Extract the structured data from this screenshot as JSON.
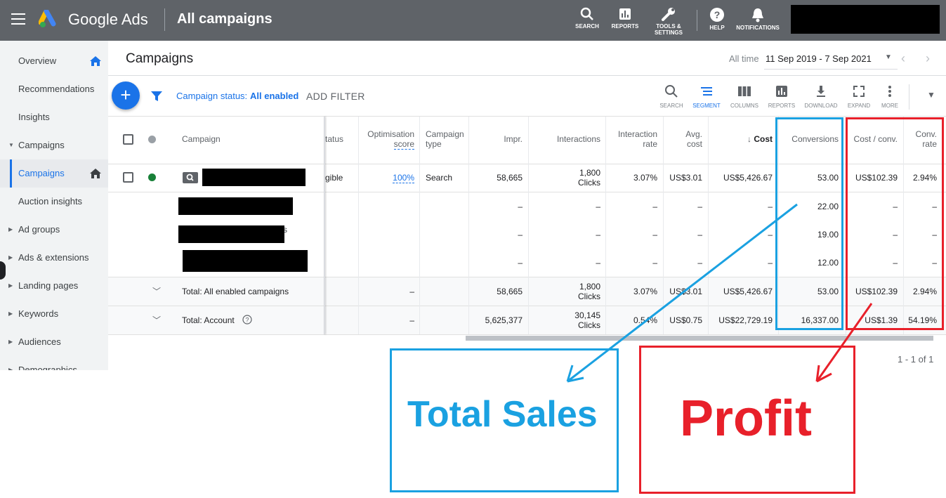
{
  "topbar": {
    "brand": "Google Ads",
    "page_title": "All campaigns",
    "buttons": [
      {
        "label": "SEARCH",
        "icon": "search-icon"
      },
      {
        "label": "REPORTS",
        "icon": "reports-icon"
      },
      {
        "label": "TOOLS &\nSETTINGS",
        "icon": "wrench-icon"
      },
      {
        "label": "HELP",
        "icon": "help-icon"
      },
      {
        "label": "NOTIFICATIONS",
        "icon": "bell-icon"
      }
    ]
  },
  "sidebar": {
    "items": [
      {
        "label": "Overview"
      },
      {
        "label": "Recommendations"
      },
      {
        "label": "Insights"
      },
      {
        "label": "Campaigns"
      },
      {
        "label": "Campaigns"
      },
      {
        "label": "Auction insights"
      },
      {
        "label": "Ad groups"
      },
      {
        "label": "Ads & extensions"
      },
      {
        "label": "Landing pages"
      },
      {
        "label": "Keywords"
      },
      {
        "label": "Audiences"
      },
      {
        "label": "Demographics"
      }
    ]
  },
  "header": {
    "title": "Campaigns",
    "date_prefix": "All time",
    "date_range": "11 Sep 2019 - 7 Sep 2021"
  },
  "toolbar": {
    "campaign_status_label": "Campaign status:",
    "campaign_status_value": "All enabled",
    "add_filter": "ADD FILTER",
    "tools": [
      {
        "label": "SEARCH",
        "icon": "search-icon"
      },
      {
        "label": "SEGMENT",
        "icon": "segment-icon"
      },
      {
        "label": "COLUMNS",
        "icon": "columns-icon"
      },
      {
        "label": "REPORTS",
        "icon": "reports-icon"
      },
      {
        "label": "DOWNLOAD",
        "icon": "download-icon"
      },
      {
        "label": "EXPAND",
        "icon": "expand-icon"
      },
      {
        "label": "MORE",
        "icon": "more-vert-icon"
      }
    ]
  },
  "table": {
    "headers": {
      "campaign": "Campaign",
      "status": "tatus",
      "optimisation_1": "Optimisation",
      "optimisation_2": "score",
      "type_1": "Campaign",
      "type_2": "type",
      "impr": "Impr.",
      "interactions": "Interactions",
      "int_rate_1": "Interaction",
      "int_rate_2": "rate",
      "avg_cost_1": "Avg.",
      "avg_cost_2": "cost",
      "cost": "Cost",
      "conversions": "Conversions",
      "cost_conv": "Cost / conv.",
      "conv_rate_1": "Conv.",
      "conv_rate_2": "rate"
    },
    "main_row": {
      "status": "gible",
      "optimisation": "100%",
      "type": "Search",
      "impr": "58,665",
      "interactions": "1,800",
      "interactions_unit": "Clicks",
      "int_rate": "3.07%",
      "avg_cost": "US$3.01",
      "cost": "US$5,426.67",
      "conversions": "53.00",
      "cost_conv": "US$102.39",
      "conv_rate": "2.94%"
    },
    "sub_rows": [
      {
        "dash": "–",
        "conversions": "22.00",
        "fragment": ""
      },
      {
        "dash": "–",
        "conversions": "19.00",
        "fragment": "s"
      },
      {
        "dash": "–",
        "conversions": "12.00",
        "fragment": ""
      }
    ],
    "total_enabled": {
      "label": "Total: All enabled campaigns",
      "optimisation": "–",
      "impr": "58,665",
      "interactions": "1,800",
      "interactions_unit": "Clicks",
      "int_rate": "3.07%",
      "avg_cost": "US$3.01",
      "cost": "US$5,426.67",
      "conversions": "53.00",
      "cost_conv": "US$102.39",
      "conv_rate": "2.94%"
    },
    "total_account": {
      "label": "Total: Account",
      "optimisation": "–",
      "impr": "5,625,377",
      "interactions": "30,145",
      "interactions_unit": "Clicks",
      "int_rate": "0.54%",
      "avg_cost": "US$0.75",
      "cost": "US$22,729.19",
      "conversions": "16,337.00",
      "cost_conv": "US$1.39",
      "conv_rate": "54.19%"
    },
    "pager": "1 - 1 of 1"
  },
  "annotations": {
    "blue_label": "Total Sales",
    "red_label": "Profit",
    "blue_color": "#1aa1e1",
    "red_color": "#e8202a"
  }
}
